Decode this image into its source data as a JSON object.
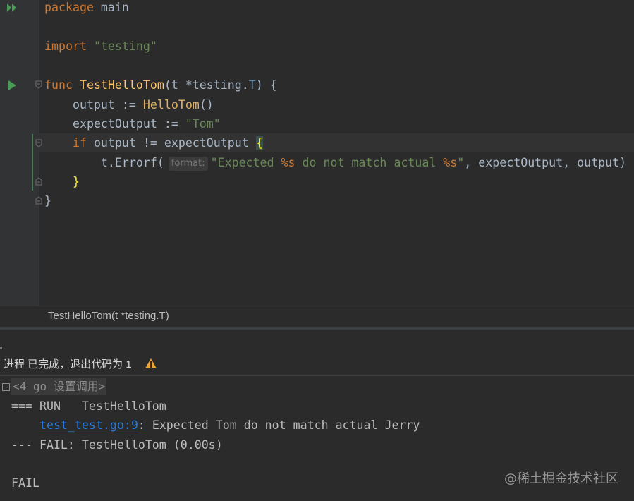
{
  "editor": {
    "lines": {
      "l1": {
        "kw": "package",
        "rest": " main"
      },
      "l2": {
        "kw": "import",
        "str": "\"testing\""
      },
      "l3": {
        "kw": "func",
        "fn": "TestHelloTom",
        "p1": "(t *testing.",
        "type": "T",
        "p2": ") {"
      },
      "l4": {
        "pre": "    output := ",
        "call": "HelloTom",
        "post": "()"
      },
      "l5": {
        "pre": "    expectOutput := ",
        "str": "\"Tom\""
      },
      "l6": {
        "kw": "    if",
        "mid": " output != expectOutput ",
        "brace": "{"
      },
      "l7": {
        "pre": "        t.Errorf(",
        "hint": "format:",
        "s1": "\"Expected ",
        "f1": "%s",
        "s2": " do not match actual ",
        "f2": "%s",
        "s3": "\"",
        "post": ", expectOutput, output)"
      },
      "l8": {
        "brace": "    }"
      },
      "l9": {
        "text": "}"
      }
    },
    "gutter_icons": {
      "run_all": "run-all-icon",
      "run_test": "run-test-icon"
    }
  },
  "breadcrumb": "TestHelloTom(t *testing.T)",
  "run_panel": {
    "status": "进程 已完成，退出代码为 1",
    "collapsed": "<4 go 设置调用>",
    "console": {
      "run_line": "=== RUN   TestHelloTom",
      "link": "test_test.go:9",
      "error_msg": ": Expected Tom do not match actual Jerry",
      "fail_line": "--- FAIL: TestHelloTom (0.00s)",
      "fail": "FAIL"
    }
  },
  "watermark": "@稀土掘金技术社区",
  "colors": {
    "background": "#2b2b2b",
    "keyword": "#cc7832",
    "string": "#6a8759",
    "function": "#ffc66d",
    "link": "#287bde",
    "run_green": "#499c54",
    "warning": "#f0a732"
  }
}
